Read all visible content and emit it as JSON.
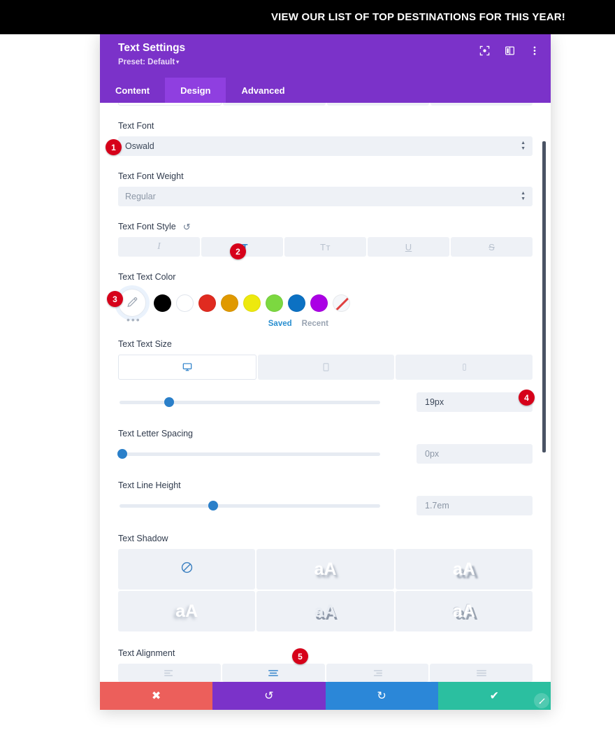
{
  "banner": {
    "text": "VIEW OUR LIST OF TOP DESTINATIONS FOR THIS YEAR!",
    "background": "#000000",
    "color": "#ffffff"
  },
  "panel": {
    "title": "Text Settings",
    "preset_label": "Preset: Default",
    "preset_caret": "▾",
    "accent": "#7b32c9",
    "tab_active_bg": "#8f3fe0",
    "header_icons": [
      {
        "name": "focus-icon",
        "label": "Focus"
      },
      {
        "name": "layout-columns-icon",
        "label": "Layout"
      },
      {
        "name": "more-vertical-icon",
        "label": "More options"
      }
    ],
    "tabs": [
      {
        "label": "Content",
        "active": false
      },
      {
        "label": "Design",
        "active": true
      },
      {
        "label": "Advanced",
        "active": false
      }
    ]
  },
  "fields": {
    "text_font": {
      "label": "Text Font",
      "value": "Oswald"
    },
    "text_font_weight": {
      "label": "Text Font Weight",
      "value": "Regular"
    },
    "text_font_style": {
      "label": "Text Font Style",
      "reset_icon": "↺",
      "options": [
        {
          "name": "italic-style-button",
          "glyph": "I",
          "active": false
        },
        {
          "name": "uppercase-style-button",
          "glyph": "TT",
          "active": true
        },
        {
          "name": "smallcaps-style-button",
          "glyph": "Tᴛ",
          "active": false
        },
        {
          "name": "underline-style-button",
          "glyph": "U",
          "active": false
        },
        {
          "name": "strikethrough-style-button",
          "glyph": "S",
          "active": false
        }
      ]
    },
    "text_color": {
      "label": "Text Text Color",
      "picker_icon": "eyedropper-icon",
      "more_dots": "•••",
      "saved_label": "Saved",
      "recent_label": "Recent",
      "swatches": [
        {
          "name": "swatch-black",
          "hex": "#000000"
        },
        {
          "name": "swatch-white",
          "hex": "#ffffff"
        },
        {
          "name": "swatch-red",
          "hex": "#e02b20"
        },
        {
          "name": "swatch-orange",
          "hex": "#e09900"
        },
        {
          "name": "swatch-yellow",
          "hex": "#ede90e"
        },
        {
          "name": "swatch-green",
          "hex": "#7cd840"
        },
        {
          "name": "swatch-blue",
          "hex": "#0c71c3"
        },
        {
          "name": "swatch-purple",
          "hex": "#ab00e5"
        },
        {
          "name": "swatch-transparent",
          "hex": "transparent"
        }
      ]
    },
    "text_size": {
      "label": "Text Text Size",
      "value": "19px",
      "slider_percent": 19,
      "devices": [
        {
          "name": "device-desktop",
          "icon": "desktop-icon",
          "active": true
        },
        {
          "name": "device-tablet",
          "icon": "tablet-icon",
          "active": false
        },
        {
          "name": "device-phone",
          "icon": "phone-icon",
          "active": false
        }
      ]
    },
    "letter_spacing": {
      "label": "Text Letter Spacing",
      "value": "0px",
      "slider_percent": 1
    },
    "line_height": {
      "label": "Text Line Height",
      "value": "1.7em",
      "slider_percent": 36
    },
    "text_shadow": {
      "label": "Text Shadow",
      "options": [
        {
          "name": "shadow-none",
          "glyph": "",
          "active": true
        },
        {
          "name": "shadow-style-1",
          "glyph": "aA",
          "active": false
        },
        {
          "name": "shadow-style-2",
          "glyph": "aA",
          "active": false
        },
        {
          "name": "shadow-style-3",
          "glyph": "aA",
          "active": false
        },
        {
          "name": "shadow-style-4",
          "glyph": "aA",
          "active": false
        },
        {
          "name": "shadow-style-5",
          "glyph": "aA",
          "active": false
        }
      ]
    },
    "text_alignment": {
      "label": "Text Alignment",
      "options": [
        {
          "name": "align-left-button",
          "active": false
        },
        {
          "name": "align-center-button",
          "active": true
        },
        {
          "name": "align-right-button",
          "active": false
        },
        {
          "name": "align-justify-button",
          "active": false
        }
      ]
    }
  },
  "footer": {
    "actions": [
      {
        "name": "cancel-button",
        "glyph": "✖",
        "color": "#ec5f5b"
      },
      {
        "name": "undo-button",
        "glyph": "↺",
        "color": "#7b32c9"
      },
      {
        "name": "redo-button",
        "glyph": "↻",
        "color": "#2b87d8"
      },
      {
        "name": "save-button",
        "glyph": "✔",
        "color": "#2bbfa0"
      }
    ],
    "resize_handle": "resize-handle-icon"
  },
  "badges": [
    {
      "number": "1",
      "target": "text-font-select"
    },
    {
      "number": "2",
      "target": "uppercase-style-button"
    },
    {
      "number": "3",
      "target": "color-picker-button"
    },
    {
      "number": "4",
      "target": "text-size-input"
    },
    {
      "number": "5",
      "target": "align-center-button"
    }
  ]
}
